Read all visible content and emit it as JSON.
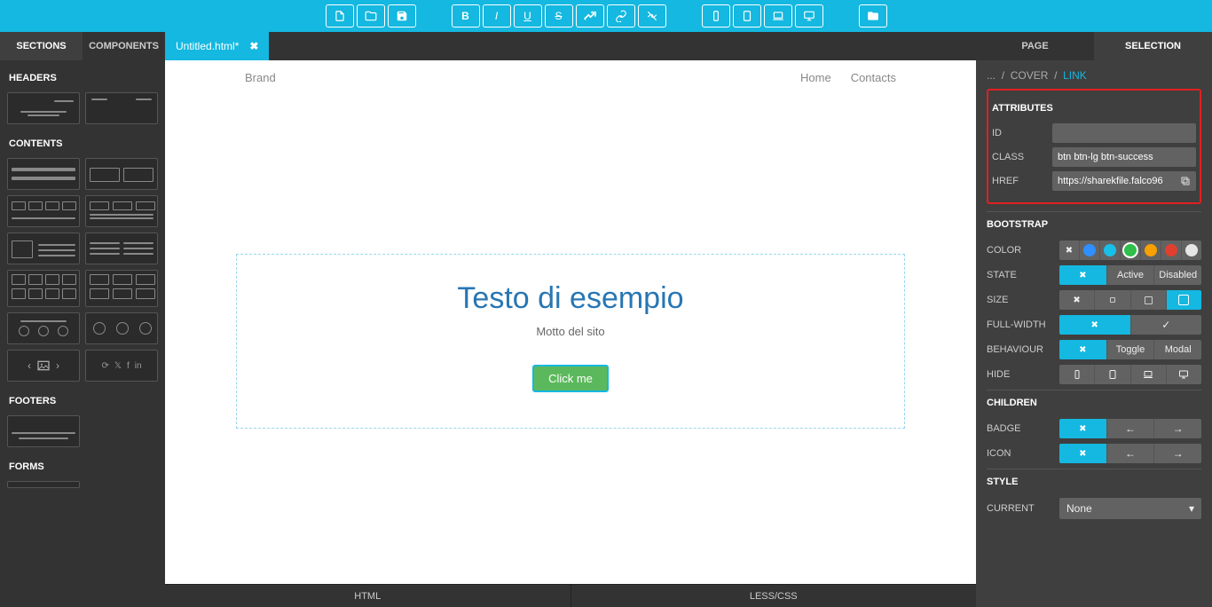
{
  "left_tabs": {
    "sections": "SECTIONS",
    "components": "COMPONENTS"
  },
  "file_tab": {
    "name": "Untitled.html*",
    "close": "✖"
  },
  "right_tabs": {
    "page": "PAGE",
    "selection": "SELECTION"
  },
  "left_panel": {
    "headers": "HEADERS",
    "contents": "CONTENTS",
    "footers": "FOOTERS",
    "forms": "FORMS"
  },
  "preview": {
    "brand": "Brand",
    "nav": {
      "home": "Home",
      "contacts": "Contacts"
    },
    "title": "Testo di esempio",
    "subtitle": "Motto del sito",
    "button": "Click me"
  },
  "bottom": {
    "html": "HTML",
    "lesscss": "LESS/CSS"
  },
  "breadcrumb": {
    "dots": "...",
    "sep": "/",
    "cover": "COVER",
    "link": "LINK"
  },
  "attributes": {
    "heading": "ATTRIBUTES",
    "id_label": "ID",
    "id_value": "",
    "class_label": "CLASS",
    "class_value": "btn btn-lg btn-success",
    "href_label": "HREF",
    "href_value": "https://sharekfile.falco96"
  },
  "bootstrap": {
    "heading": "BOOTSTRAP",
    "color_label": "COLOR",
    "colors": [
      "#888888",
      "#2f8fff",
      "#17c0e8",
      "#2fbf4a",
      "#f8a000",
      "#e04030",
      "#e6e6e6"
    ],
    "color_selected_index": 3,
    "state_label": "STATE",
    "state": {
      "active": "Active",
      "disabled": "Disabled"
    },
    "size_label": "SIZE",
    "fullwidth_label": "FULL-WIDTH",
    "behaviour_label": "BEHAVIOUR",
    "behaviour": {
      "toggle": "Toggle",
      "modal": "Modal"
    },
    "hide_label": "HIDE"
  },
  "children": {
    "heading": "CHILDREN",
    "badge_label": "BADGE",
    "icon_label": "ICON"
  },
  "style": {
    "heading": "STYLE",
    "current_label": "CURRENT",
    "current_value": "None"
  }
}
